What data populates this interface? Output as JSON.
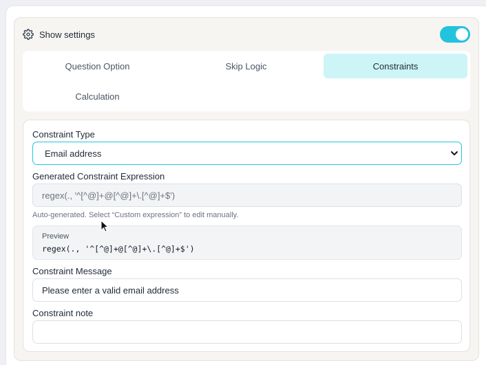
{
  "settings": {
    "header_label": "Show settings",
    "toggle_on": true,
    "accent_color": "#22c3dd"
  },
  "tabs": [
    {
      "label": "Question Option",
      "active": false
    },
    {
      "label": "Skip Logic",
      "active": false
    },
    {
      "label": "Constraints",
      "active": true
    },
    {
      "label": "Calculation",
      "active": false
    }
  ],
  "form": {
    "constraint_type": {
      "label": "Constraint Type",
      "value": "Email address"
    },
    "generated_expression": {
      "label": "Generated Constraint Expression",
      "value": "regex(., '^[^@]+@[^@]+\\.[^@]+$')",
      "hint": "Auto-generated. Select “Custom expression” to edit manually."
    },
    "preview": {
      "label": "Preview",
      "code": "regex(., '^[^@]+@[^@]+\\.[^@]+$')"
    },
    "constraint_message": {
      "label": "Constraint Message",
      "value": "Please enter a valid email address"
    },
    "constraint_note": {
      "label": "Constraint note",
      "value": ""
    }
  }
}
